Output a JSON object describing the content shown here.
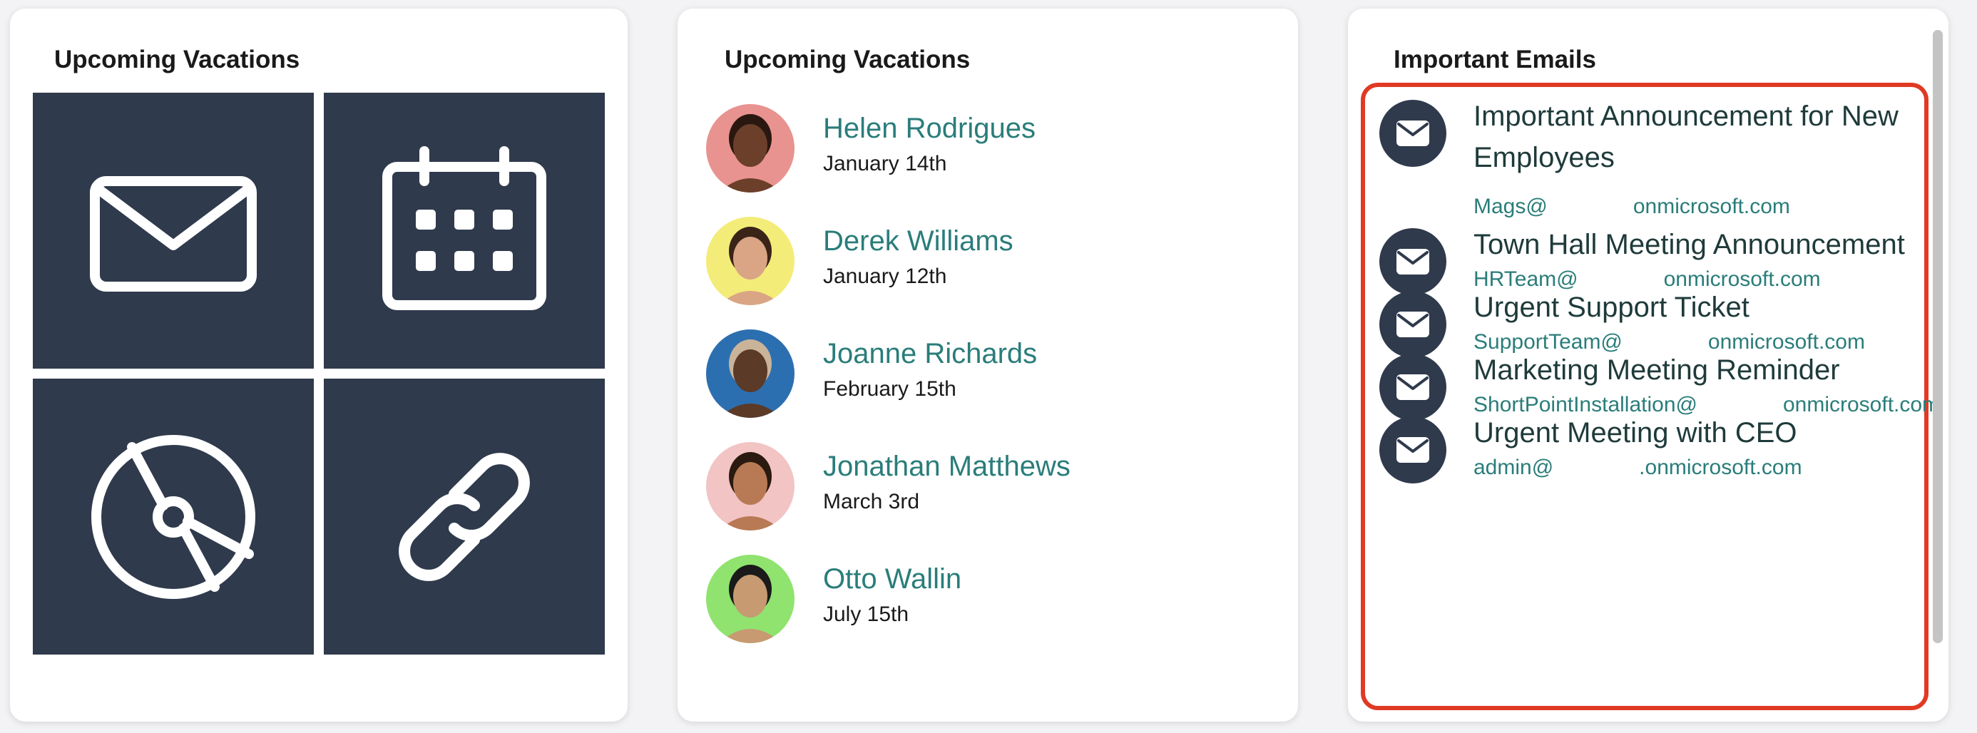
{
  "card1": {
    "title": "Upcoming Vacations",
    "tiles": [
      {
        "icon": "mail-icon"
      },
      {
        "icon": "calendar-icon"
      },
      {
        "icon": "disc-icon"
      },
      {
        "icon": "link-icon"
      }
    ]
  },
  "card2": {
    "title": "Upcoming Vacations",
    "people": [
      {
        "name": "Helen Rodrigues",
        "date": "January 14th",
        "bg": "#e8938f",
        "skin": "#6b3f2a",
        "hair": "#2a1810"
      },
      {
        "name": "Derek Williams",
        "date": "January 12th",
        "bg": "#f3ec78",
        "skin": "#d9a585",
        "hair": "#3a2418"
      },
      {
        "name": "Joanne Richards",
        "date": "February 15th",
        "bg": "#2c6fb0",
        "skin": "#5b3a28",
        "hair": "#c9b49a"
      },
      {
        "name": "Jonathan Matthews",
        "date": "March 3rd",
        "bg": "#f2c4c4",
        "skin": "#b87a55",
        "hair": "#2a1a10"
      },
      {
        "name": "Otto Wallin",
        "date": "July 15th",
        "bg": "#8fe36e",
        "skin": "#c79a72",
        "hair": "#1a1a1a"
      }
    ]
  },
  "card3": {
    "title": "Important Emails",
    "emails": [
      {
        "subject": "Important Announcement for New Employees",
        "from_user": "Mags@",
        "from_domain": "onmicrosoft.com"
      },
      {
        "subject": "Town Hall Meeting Announcement",
        "from_user": "HRTeam@",
        "from_domain": "onmicrosoft.com"
      },
      {
        "subject": "Urgent Support Ticket",
        "from_user": "SupportTeam@",
        "from_domain": "onmicrosoft.com"
      },
      {
        "subject": "Marketing Meeting Reminder",
        "from_user": "ShortPointInstallation@",
        "from_domain": "onmicrosoft.com"
      },
      {
        "subject": "Urgent Meeting with CEO",
        "from_user": "admin@",
        "from_domain": ".onmicrosoft.com"
      }
    ]
  },
  "colors": {
    "tile_bg": "#2f3a4c",
    "accent_teal": "#2a7d7a",
    "highlight_border": "#e03a24"
  }
}
